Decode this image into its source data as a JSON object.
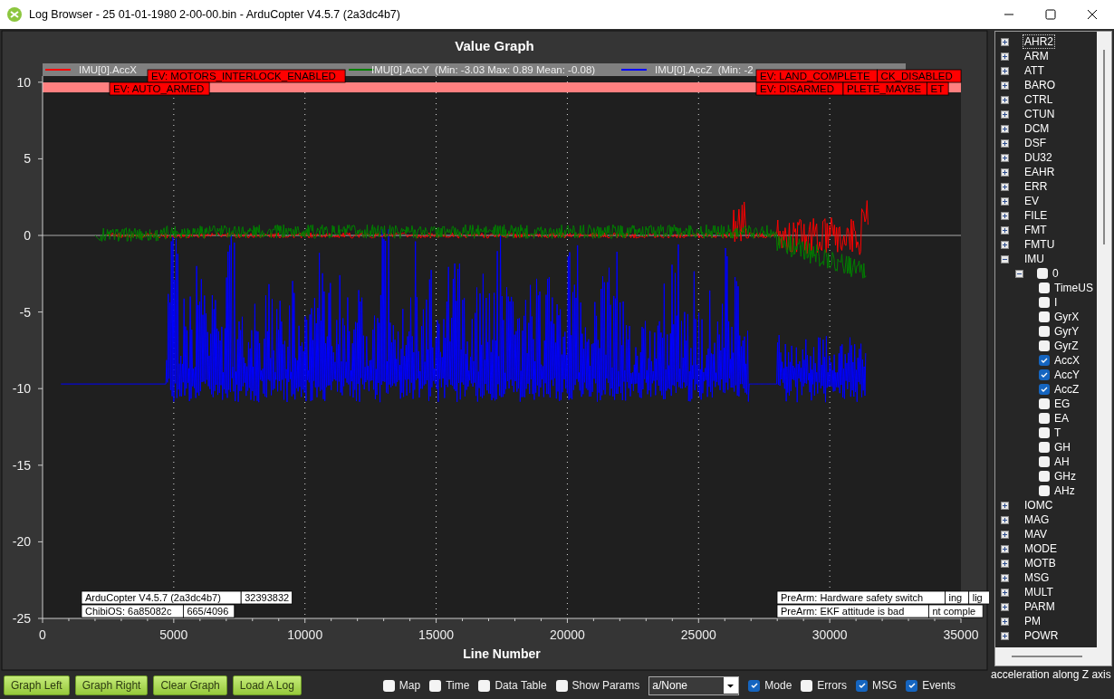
{
  "window": {
    "title": "Log Browser - 25 01-01-1980 2-00-00.bin - ArduCopter V4.5.7 (2a3dc4b7)"
  },
  "graph": {
    "title": "Value Graph",
    "legend": [
      {
        "label": "IMU[0].AccX",
        "color": "#ff0000"
      },
      {
        "label": "IMU[0].AccY  (Min: -3.03 Max: 0.89 Mean: -0.08)",
        "color": "#008000"
      },
      {
        "label": "IMU[0].AccZ  (Min: -2",
        "color": "#0000ff"
      }
    ],
    "events": [
      "EV: MOTORS_INTERLOCK_ENABLED",
      "EV: LAND_COMPLETE",
      "CK_DISABLED",
      "EV: AUTO_ARMED",
      "EV: DISARMED",
      "PLETE_MAYBE",
      "ET"
    ],
    "annotations": [
      "ArduCopter V4.5.7 (2a3dc4b7)",
      "32393832",
      "PreArm: Hardware safety switch",
      "ing",
      "lig",
      "ChibiOS: 6a85082c",
      "665/4096",
      "PreArm: EKF attitude is bad",
      "nt comple"
    ],
    "y_ticks": [
      "10",
      "5",
      "0",
      "-5",
      "-10",
      "-15",
      "-20",
      "-25"
    ],
    "x_ticks": [
      "0",
      "5000",
      "10000",
      "15000",
      "20000",
      "25000",
      "30000",
      "35000"
    ],
    "xlabel": "Line Number"
  },
  "tree": {
    "items": [
      {
        "label": "AHR2",
        "expanded": false,
        "focused": true
      },
      {
        "label": "ARM",
        "expanded": false,
        "focused": false
      },
      {
        "label": "ATT",
        "expanded": false,
        "focused": false
      },
      {
        "label": "BARO",
        "expanded": false,
        "focused": false
      },
      {
        "label": "CTRL",
        "expanded": false,
        "focused": false
      },
      {
        "label": "CTUN",
        "expanded": false,
        "focused": false
      },
      {
        "label": "DCM",
        "expanded": false,
        "focused": false
      },
      {
        "label": "DSF",
        "expanded": false,
        "focused": false
      },
      {
        "label": "DU32",
        "expanded": false,
        "focused": false
      },
      {
        "label": "EAHR",
        "expanded": false,
        "focused": false
      },
      {
        "label": "ERR",
        "expanded": false,
        "focused": false
      },
      {
        "label": "EV",
        "expanded": false,
        "focused": false
      },
      {
        "label": "FILE",
        "expanded": false,
        "focused": false
      },
      {
        "label": "FMT",
        "expanded": false,
        "focused": false
      },
      {
        "label": "FMTU",
        "expanded": false,
        "focused": false
      },
      {
        "label": "IMU",
        "expanded": true,
        "focused": false,
        "children": [
          {
            "label": "0",
            "expanded": true,
            "checked": false,
            "children": [
              {
                "label": "TimeUS",
                "checked": false
              },
              {
                "label": "I",
                "checked": false
              },
              {
                "label": "GyrX",
                "checked": false
              },
              {
                "label": "GyrY",
                "checked": false
              },
              {
                "label": "GyrZ",
                "checked": false
              },
              {
                "label": "AccX",
                "checked": true
              },
              {
                "label": "AccY",
                "checked": true
              },
              {
                "label": "AccZ",
                "checked": true
              },
              {
                "label": "EG",
                "checked": false
              },
              {
                "label": "EA",
                "checked": false
              },
              {
                "label": "T",
                "checked": false
              },
              {
                "label": "GH",
                "checked": false
              },
              {
                "label": "AH",
                "checked": false
              },
              {
                "label": "GHz",
                "checked": false
              },
              {
                "label": "AHz",
                "checked": false
              }
            ]
          }
        ]
      },
      {
        "label": "IOMC",
        "expanded": false,
        "focused": false
      },
      {
        "label": "MAG",
        "expanded": false,
        "focused": false
      },
      {
        "label": "MAV",
        "expanded": false,
        "focused": false
      },
      {
        "label": "MODE",
        "expanded": false,
        "focused": false
      },
      {
        "label": "MOTB",
        "expanded": false,
        "focused": false
      },
      {
        "label": "MSG",
        "expanded": false,
        "focused": false
      },
      {
        "label": "MULT",
        "expanded": false,
        "focused": false
      },
      {
        "label": "PARM",
        "expanded": false,
        "focused": false
      },
      {
        "label": "PM",
        "expanded": false,
        "focused": false
      },
      {
        "label": "POWR",
        "expanded": false,
        "focused": false
      }
    ]
  },
  "status_text": "acceleration along Z axis",
  "toolbar": {
    "buttons": [
      "Graph Left",
      "Graph Right",
      "Clear Graph",
      "Load A Log"
    ],
    "options_left": [
      {
        "label": "Map",
        "checked": false
      },
      {
        "label": "Time",
        "checked": false
      },
      {
        "label": "Data Table",
        "checked": false
      },
      {
        "label": "Show Params",
        "checked": false
      }
    ],
    "dropdown": "a/None",
    "options_right": [
      {
        "label": "Mode",
        "checked": true
      },
      {
        "label": "Errors",
        "checked": false
      },
      {
        "label": "MSG",
        "checked": true
      },
      {
        "label": "Events",
        "checked": true
      }
    ]
  }
}
